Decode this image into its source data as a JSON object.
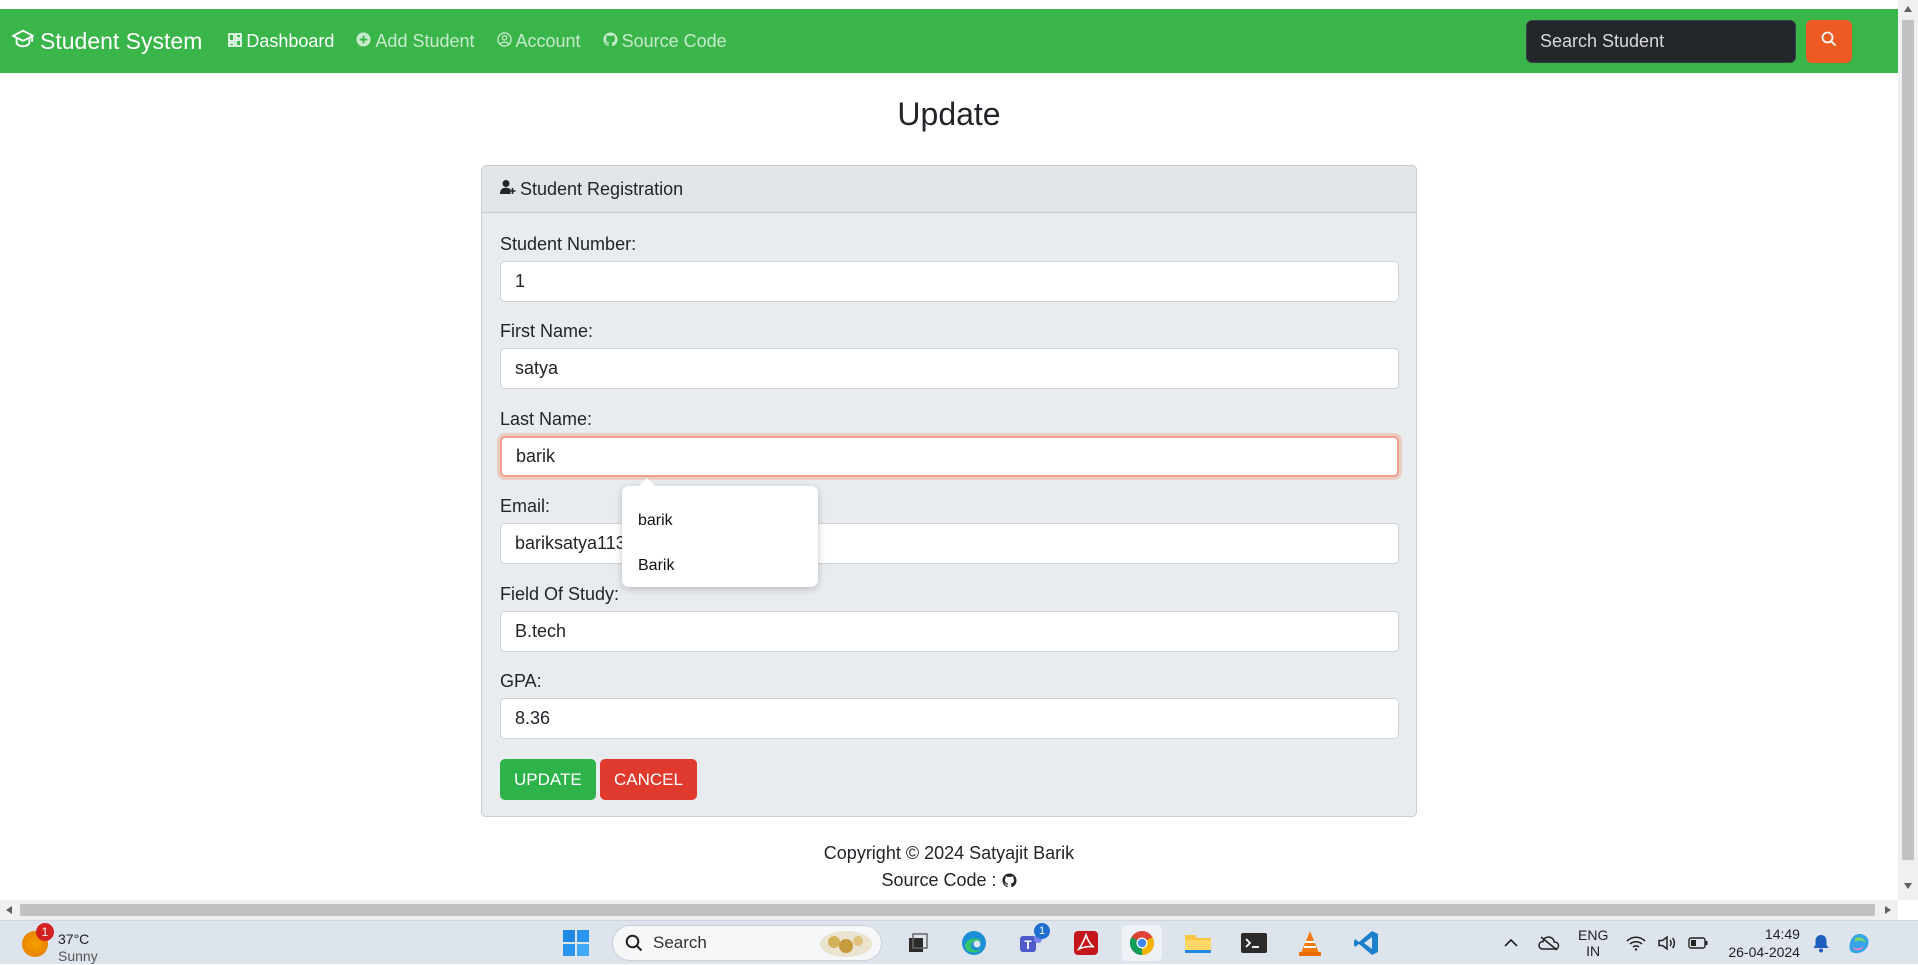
{
  "navbar": {
    "brand": "Student System",
    "links": [
      {
        "label": "Dashboard",
        "icon": "dashboard-icon",
        "active": true
      },
      {
        "label": "Add Student",
        "icon": "plus-circle-icon",
        "active": false
      },
      {
        "label": "Account",
        "icon": "user-circle-icon",
        "active": false
      },
      {
        "label": "Source Code",
        "icon": "github-icon",
        "active": false
      }
    ],
    "search_placeholder": "Search Student",
    "search_button_icon": "search-icon"
  },
  "page": {
    "title": "Update"
  },
  "form": {
    "header": "Student Registration",
    "fields": [
      {
        "label": "Student Number:",
        "value": "1"
      },
      {
        "label": "First Name:",
        "value": "satya"
      },
      {
        "label": "Last Name:",
        "value": "barik",
        "focused": true
      },
      {
        "label": "Email:",
        "value": "bariksatya113"
      },
      {
        "label": "Field Of Study:",
        "value": "B.tech"
      },
      {
        "label": "GPA:",
        "value": "8.36"
      }
    ],
    "update_label": "UPDATE",
    "cancel_label": "CANCEL",
    "autocomplete": [
      "barik",
      "Barik"
    ]
  },
  "footer": {
    "copyright": "Copyright © 2024 Satyajit Barik",
    "source_label": "Source Code :"
  },
  "taskbar": {
    "weather_temp": "37°C",
    "weather_cond": "Sunny",
    "weather_badge": "1",
    "search_label": "Search",
    "teams_badge": "1",
    "lang_line1": "ENG",
    "lang_line2": "IN",
    "time": "14:49",
    "date": "26-04-2024"
  },
  "colors": {
    "navbar": "#3ab54a",
    "search_button": "#ee5a24",
    "update_button": "#2eb24a",
    "cancel_button": "#e03a2f"
  }
}
